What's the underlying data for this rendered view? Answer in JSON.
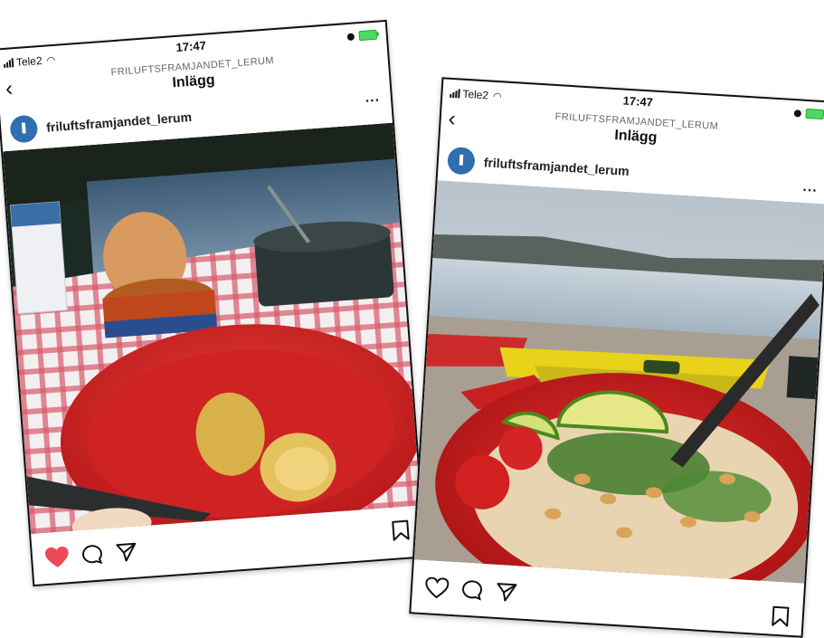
{
  "posts": [
    {
      "status": {
        "carrier": "Tele2",
        "time": "17:47"
      },
      "header": {
        "subtitle": "FRILUFTSFRAMJANDET_LERUM",
        "title": "Inlägg",
        "back_icon": "chevron-left-icon"
      },
      "account": {
        "username": "friluftsframjandet_lerum",
        "more_label": "..."
      },
      "photo": {
        "description_icon": "food-photo-lake-picnic"
      },
      "actions": {
        "liked": true,
        "like_color": "#ed4956"
      }
    },
    {
      "status": {
        "carrier": "Tele2",
        "time": "17:47"
      },
      "header": {
        "subtitle": "FRILUFTSFRAMJANDET_LERUM",
        "title": "Inlägg",
        "back_icon": "chevron-left-icon"
      },
      "account": {
        "username": "friluftsframjandet_lerum",
        "more_label": "..."
      },
      "photo": {
        "description_icon": "food-photo-kayak-beach"
      },
      "actions": {
        "liked": false,
        "like_color": "#111111"
      }
    }
  ]
}
